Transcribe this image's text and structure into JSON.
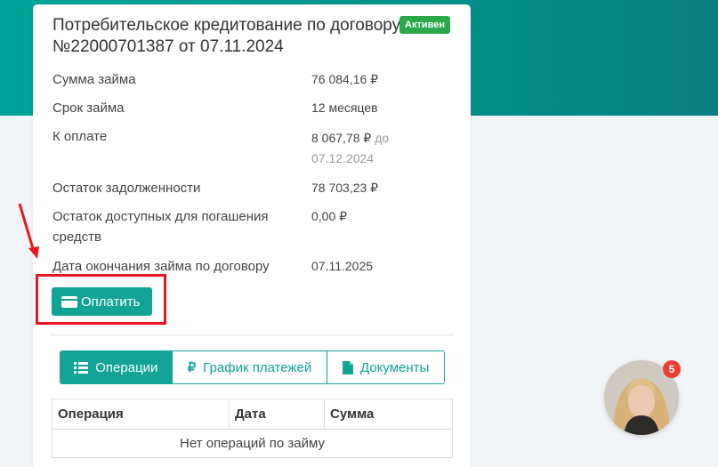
{
  "loan": {
    "title": "Потребительское кредитование по договору №22000701387 от 07.11.2024",
    "status": "Активен",
    "rows": [
      {
        "label": "Сумма займа",
        "value": "76 084,16 ₽"
      },
      {
        "label": "Срок займа",
        "value": "12 месяцев"
      },
      {
        "label": "К оплате",
        "value": "8 067,78 ₽",
        "value_suffix": "до 07.12.2024"
      },
      {
        "label": "Остаток задолженности",
        "value": "78 703,23 ₽"
      },
      {
        "label": "Остаток доступных для погашения средств",
        "value": "0,00 ₽"
      },
      {
        "label": "Дата окончания займа по договору",
        "value": "07.11.2025"
      }
    ],
    "pay_button": "Оплатить"
  },
  "tabs": [
    {
      "label": "Операции",
      "icon": "list-icon",
      "active": true
    },
    {
      "label": "График платежей",
      "icon": "ruble-icon",
      "active": false
    },
    {
      "label": "Документы",
      "icon": "document-icon",
      "active": false
    }
  ],
  "operations_table": {
    "columns": [
      "Операция",
      "Дата",
      "Сумма"
    ],
    "empty_message": "Нет операций по займу"
  },
  "chat": {
    "unread_count": "5"
  },
  "colors": {
    "accent": "#12a497",
    "badge": "#2aa84a",
    "annotation": "#e8151f",
    "notification": "#ec3c35"
  }
}
